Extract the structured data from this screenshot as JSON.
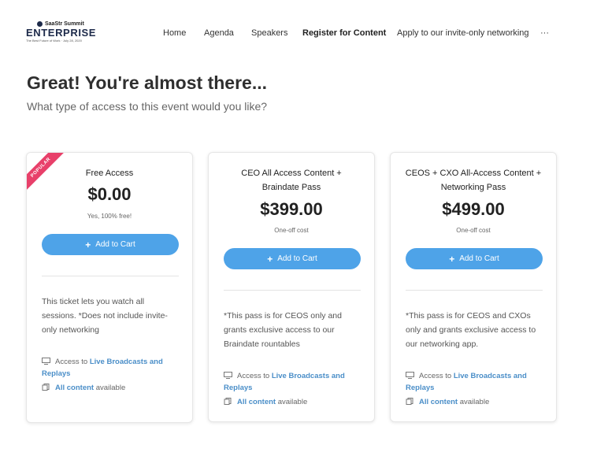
{
  "logo": {
    "top": "SaaStr Summit",
    "main": "ENTERPRISE",
    "sub": "The Best Future of Work · July 28, 2020"
  },
  "nav": {
    "home": "Home",
    "agenda": "Agenda",
    "speakers": "Speakers",
    "register": "Register for Content",
    "apply": "Apply to our invite-only networking",
    "more": "···"
  },
  "page": {
    "title": "Great! You're almost there...",
    "subtitle": "What type of access to this event would you like?"
  },
  "cards": [
    {
      "ribbon": "POPULAR",
      "title_line1": "Free Access",
      "title_line2": "",
      "price": "$0.00",
      "note": "Yes, 100% free!",
      "button": "Add to Cart",
      "desc_lines": [
        "This ticket lets you watch all",
        "sessions. *Does not include invite-",
        "only networking"
      ],
      "access_prefix": "Access to",
      "access_hl1": "Live Broadcasts and",
      "access_hl2": "Replays",
      "content_hl": "All content",
      "content_suffix": "available"
    },
    {
      "title_line1": "CEO All Access Content +",
      "title_line2": "Braindate Pass",
      "price": "$399.00",
      "note": "One-off cost",
      "button": "Add to Cart",
      "desc_lines": [
        "*This pass is for CEOS only and",
        "grants exclusive access to our",
        "Braindate rountables"
      ],
      "access_prefix": "Access to",
      "access_hl1": "Live Broadcasts and",
      "access_hl2": "Replays",
      "content_hl": "All content",
      "content_suffix": "available"
    },
    {
      "title_line1": "CEOS + CXO All-Access Content +",
      "title_line2": "Networking Pass",
      "price": "$499.00",
      "note": "One-off cost",
      "button": "Add to Cart",
      "desc_lines": [
        "*This pass is for CEOS and CXOs",
        "only and grants exclusive access to",
        "our networking app."
      ],
      "access_prefix": "Access to",
      "access_hl1": "Live Broadcasts and",
      "access_hl2": "Replays",
      "content_hl": "All content",
      "content_suffix": "available"
    }
  ],
  "icons": {
    "monitor": "monitor-icon",
    "copy": "copy-icon",
    "plus": "plus-icon"
  },
  "colors": {
    "accent": "#4ea3e8",
    "ribbon": "#e8406a",
    "link": "#4a8ec8"
  }
}
